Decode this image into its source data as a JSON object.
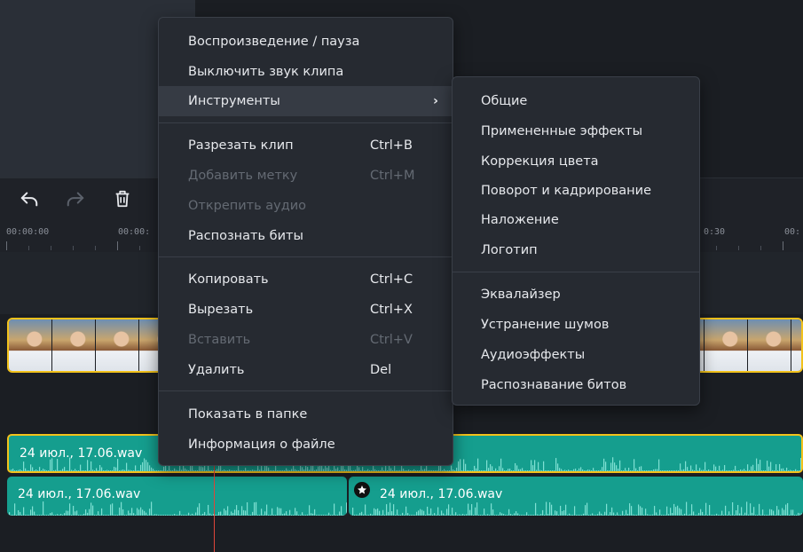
{
  "colors": {
    "accent": "#f2c21b",
    "audio_clip": "#159e8e",
    "playhead": "#e0453a",
    "menu_bg": "#262a31",
    "menu_highlight": "#363b44"
  },
  "toolbar": {
    "undo_icon": "undo-icon",
    "redo_icon": "redo-icon",
    "delete_icon": "trash-icon"
  },
  "ruler": {
    "labels": [
      "00:00:00",
      "00:00:",
      "0:30",
      "00:"
    ]
  },
  "audio_clips": [
    {
      "label": "24 июл., 17.06.wav"
    },
    {
      "label": "24 июл., 17.06.wav"
    },
    {
      "label": "24 июл., 17.06.wav"
    }
  ],
  "context_menu": {
    "items": [
      {
        "label": "Воспроизведение / пауза",
        "shortcut": ""
      },
      {
        "label": "Выключить звук клипа",
        "shortcut": ""
      },
      {
        "label": "Инструменты",
        "shortcut": ""
      },
      {
        "label": "Разрезать клип",
        "shortcut": "Ctrl+B"
      },
      {
        "label": "Добавить метку",
        "shortcut": "Ctrl+M"
      },
      {
        "label": "Открепить аудио",
        "shortcut": ""
      },
      {
        "label": "Распознать биты",
        "shortcut": ""
      },
      {
        "label": "Копировать",
        "shortcut": "Ctrl+C"
      },
      {
        "label": "Вырезать",
        "shortcut": "Ctrl+X"
      },
      {
        "label": "Вставить",
        "shortcut": "Ctrl+V"
      },
      {
        "label": "Удалить",
        "shortcut": "Del"
      },
      {
        "label": "Показать в папке",
        "shortcut": ""
      },
      {
        "label": "Информация о файле",
        "shortcut": ""
      }
    ],
    "submenu_arrow": "›"
  },
  "submenu": {
    "items": [
      {
        "label": "Общие"
      },
      {
        "label": "Примененные эффекты"
      },
      {
        "label": "Коррекция цвета"
      },
      {
        "label": "Поворот и кадрирование"
      },
      {
        "label": "Наложение"
      },
      {
        "label": "Логотип"
      },
      {
        "label": "Эквалайзер"
      },
      {
        "label": "Устранение шумов"
      },
      {
        "label": "Аудиоэффекты"
      },
      {
        "label": "Распознавание битов"
      }
    ]
  }
}
